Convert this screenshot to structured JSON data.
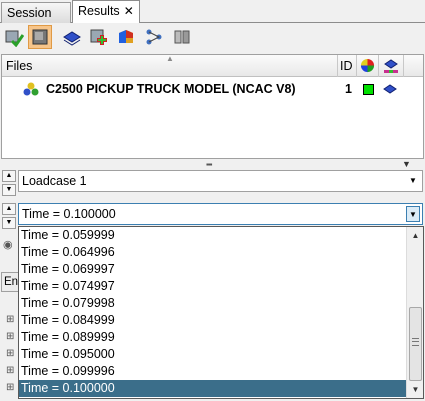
{
  "tabs": [
    {
      "label": "Session"
    },
    {
      "label": "Results",
      "close": "✕"
    }
  ],
  "toolbar": {
    "icons": [
      "open-model-icon",
      "display-icon",
      "layer-icon",
      "add-icon",
      "contour-icon",
      "tree-icon",
      "cylinders-icon"
    ]
  },
  "files": {
    "header": {
      "files": "Files",
      "id": "ID"
    },
    "rows": [
      {
        "name": "C2500 PICKUP TRUCK MODEL (NCAC V8)",
        "id": "1",
        "color": "#00e000"
      }
    ]
  },
  "loadcase": {
    "value": "Loadcase 1"
  },
  "time": {
    "value": "Time = 0.100000"
  },
  "tree": {
    "en_label": "En"
  },
  "dropdown": {
    "items": [
      "Time = 0.059999",
      "Time = 0.064996",
      "Time = 0.069997",
      "Time = 0.074997",
      "Time = 0.079998",
      "Time = 0.084999",
      "Time = 0.089999",
      "Time = 0.095000",
      "Time = 0.099996",
      "Time = 0.100000"
    ],
    "selected_index": 9
  },
  "colors": {
    "selection": "#3b6e8a",
    "active_tool": "#f7c58a",
    "model_color": "#00e000"
  }
}
